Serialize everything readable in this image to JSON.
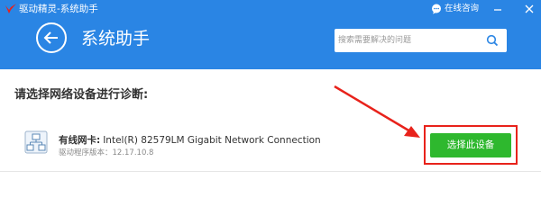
{
  "window": {
    "title": "驱动精灵-系统助手"
  },
  "titlebar": {
    "consult_label": "在线咨询"
  },
  "header": {
    "page_title": "系统助手",
    "search_placeholder": "搜索需要解决的问题"
  },
  "main": {
    "prompt": "请选择网络设备进行诊断:",
    "device": {
      "label": "有线网卡:",
      "name": "Intel(R) 82579LM Gigabit Network Connection",
      "driver_version": "驱动程序版本：12.17.10.8",
      "select_label": "选择此设备"
    }
  },
  "colors": {
    "header_bg": "#2a85e4",
    "select_button": "#2eb82e",
    "annotation_red": "#e8221b"
  },
  "icons": {
    "logo": "drivergenius-logo",
    "consult": "chat-bubble-icon",
    "back": "arrow-left-icon",
    "search": "search-icon",
    "device": "network-device-icon"
  }
}
